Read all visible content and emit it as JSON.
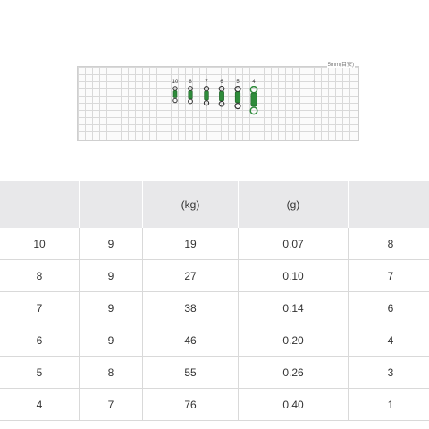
{
  "diagram": {
    "scale_label": "5mm(目安)",
    "swivel_sizes": [
      "10",
      "8",
      "7",
      "6",
      "5",
      "4"
    ]
  },
  "table": {
    "headers": [
      "",
      "",
      "(kg)",
      "(g)",
      ""
    ],
    "rows": [
      [
        "10",
        "9",
        "19",
        "0.07",
        "8"
      ],
      [
        "8",
        "9",
        "27",
        "0.10",
        "7"
      ],
      [
        "7",
        "9",
        "38",
        "0.14",
        "6"
      ],
      [
        "6",
        "9",
        "46",
        "0.20",
        "4"
      ],
      [
        "5",
        "8",
        "55",
        "0.26",
        "3"
      ],
      [
        "4",
        "7",
        "76",
        "0.40",
        "1"
      ]
    ]
  },
  "colors": {
    "swivel_body": "#2e8b3a",
    "header_bg": "#e8e8ea"
  }
}
